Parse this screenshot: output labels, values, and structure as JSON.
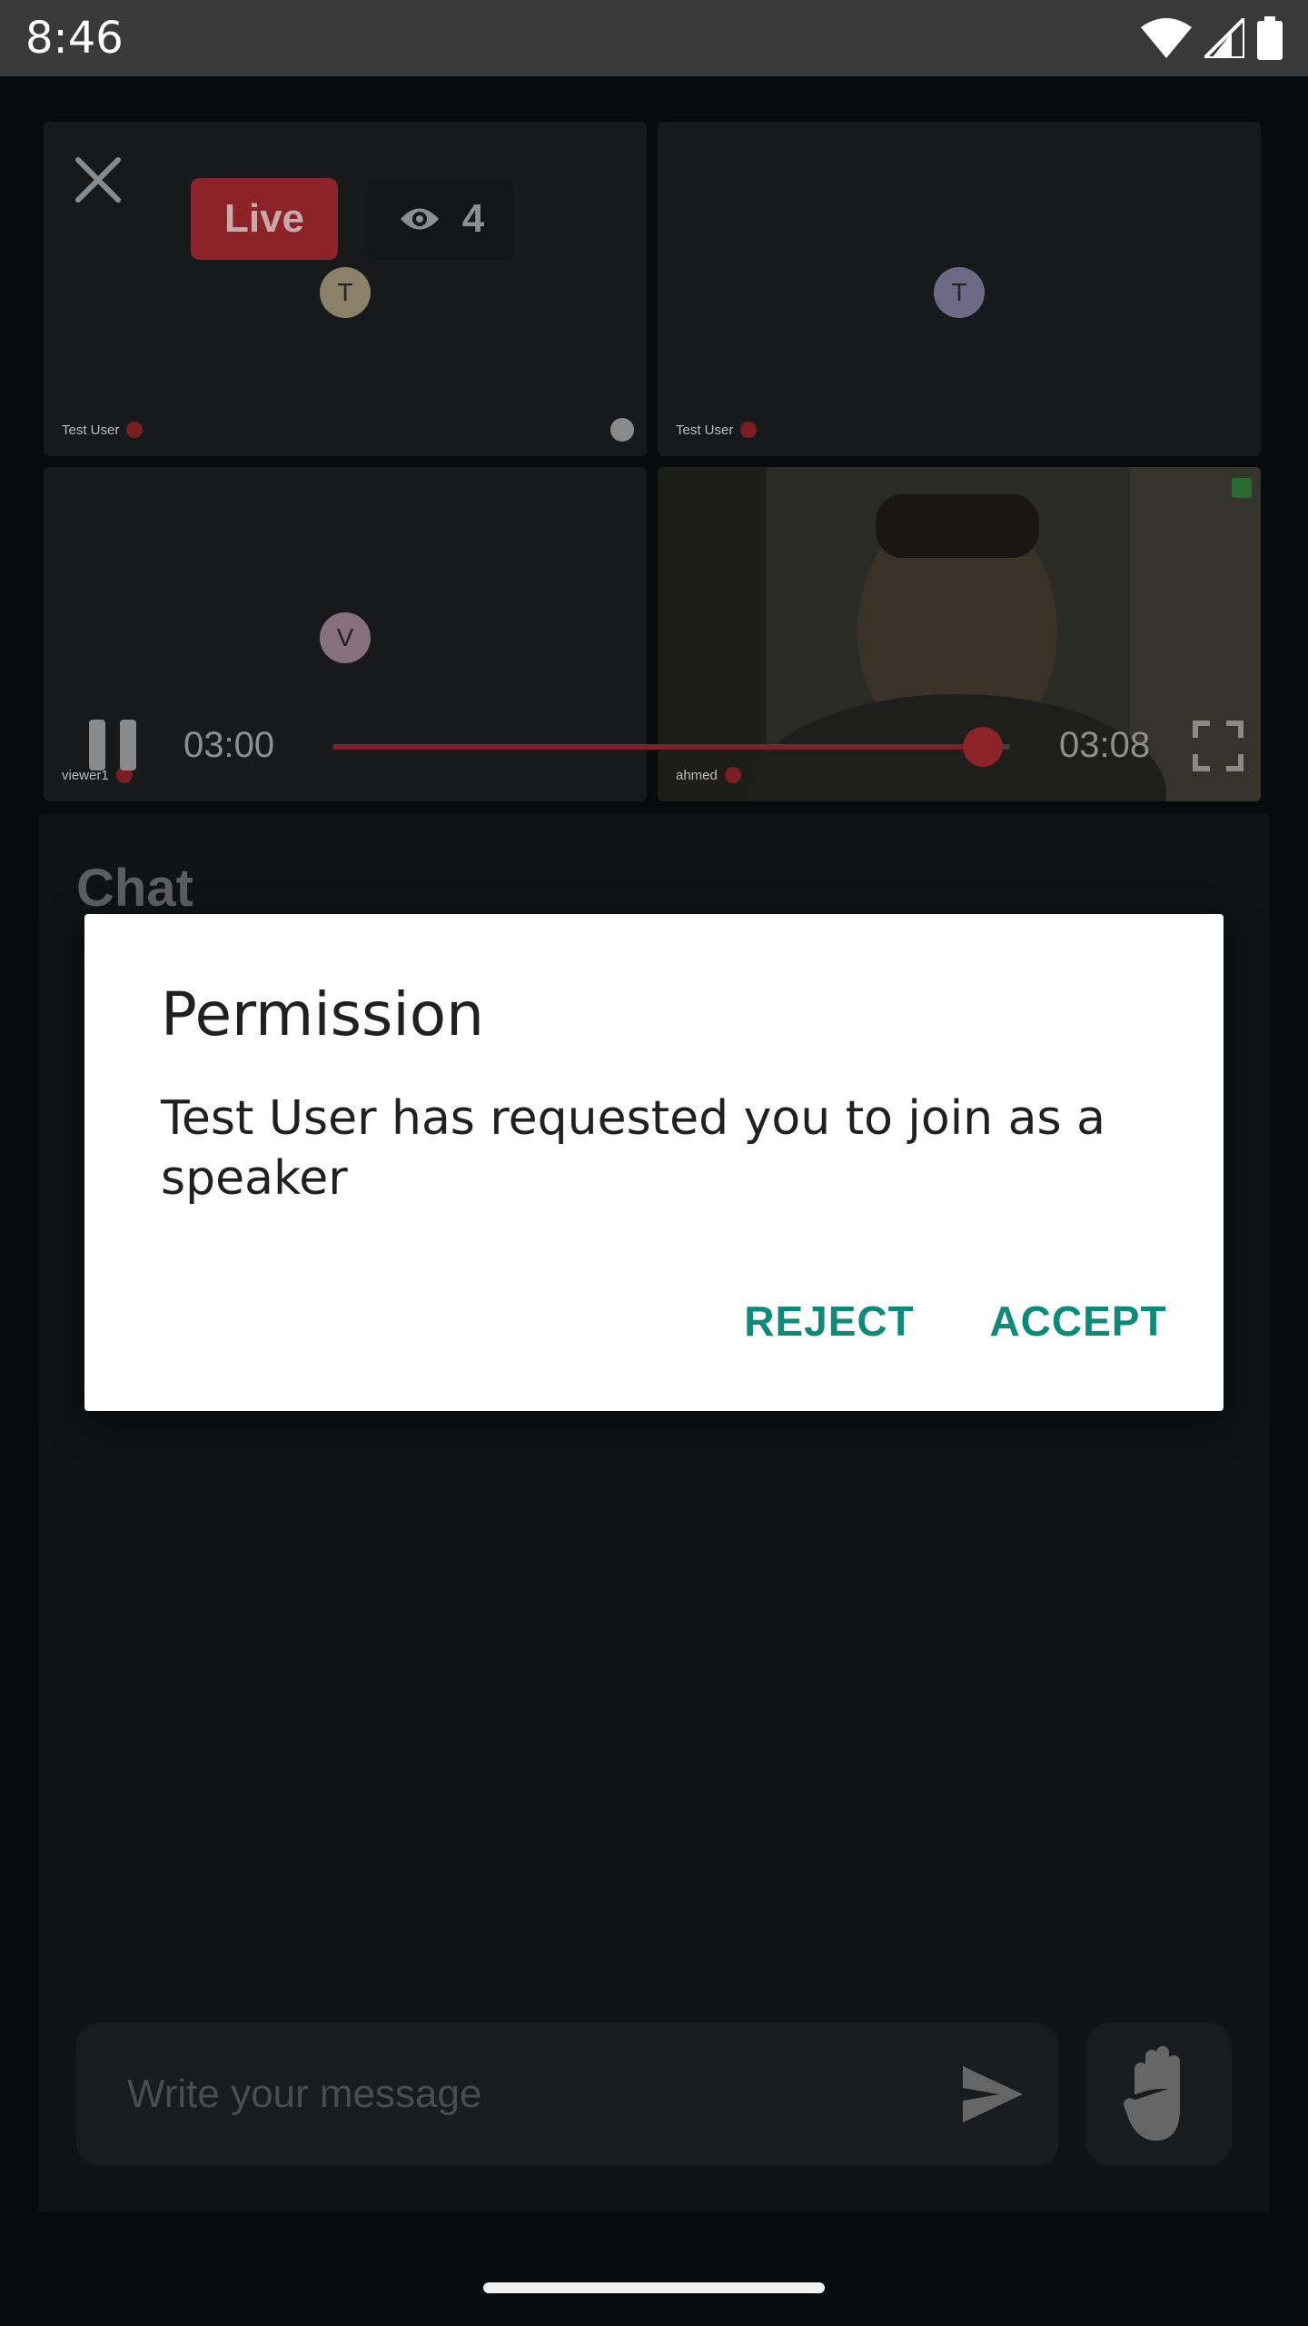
{
  "status_bar": {
    "time": "8:46"
  },
  "stream": {
    "live_label": "Live",
    "viewer_count": "4",
    "tiles": [
      {
        "initial": "T",
        "name": "Test User",
        "avatar_color": "#8a8168"
      },
      {
        "initial": "T",
        "name": "Test User",
        "avatar_color": "#6e6a86"
      },
      {
        "initial": "V",
        "name": "viewer1",
        "avatar_color": "#86707e"
      },
      {
        "name": "ahmed"
      }
    ]
  },
  "playback": {
    "current_time": "03:00",
    "total_time": "03:08",
    "progress": 0.96
  },
  "chat": {
    "title": "Chat",
    "input_placeholder": "Write your message"
  },
  "dialog": {
    "title": "Permission",
    "message": "Test User has requested you to join as a speaker",
    "reject_label": "REJECT",
    "accept_label": "ACCEPT"
  },
  "colors": {
    "accent": "#0d8a7a",
    "live_red": "#8c2328"
  }
}
